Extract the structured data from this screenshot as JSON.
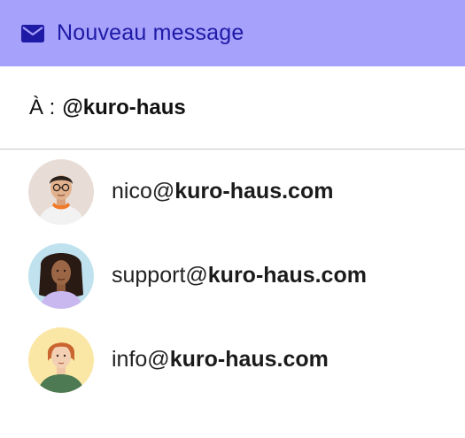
{
  "header": {
    "title": "Nouveau message",
    "icon": "envelope-icon",
    "background": "#a6a1fb",
    "accent": "#1f1aa6"
  },
  "to_field": {
    "label": "À :",
    "value": "@kuro-haus"
  },
  "suggestions": [
    {
      "local": "nico@",
      "domain": "kuro-haus.com",
      "avatar_bg": "#e8ddd6"
    },
    {
      "local": "support@",
      "domain": "kuro-haus.com",
      "avatar_bg": "#bfe2ee"
    },
    {
      "local": "info@",
      "domain": "kuro-haus.com",
      "avatar_bg": "#fbe7a5"
    }
  ]
}
